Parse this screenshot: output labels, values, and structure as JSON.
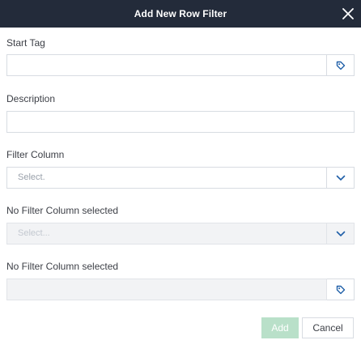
{
  "header": {
    "title": "Add New Row Filter",
    "close_icon": "close-icon"
  },
  "form": {
    "start_tag": {
      "label": "Start Tag",
      "value": "",
      "button_icon": "tag-icon"
    },
    "description": {
      "label": "Description",
      "value": ""
    },
    "filter_column": {
      "label": "Filter Column",
      "placeholder": "Select.",
      "button_icon": "chevron-down-icon"
    },
    "second_column": {
      "label": "No Filter Column selected",
      "placeholder": "Select...",
      "disabled": true,
      "button_icon": "chevron-down-icon"
    },
    "third_column": {
      "label": "No Filter Column selected",
      "value": "",
      "disabled": true,
      "button_icon": "tag-icon"
    }
  },
  "footer": {
    "add_label": "Add",
    "cancel_label": "Cancel"
  },
  "colors": {
    "header_bg": "#232b3a",
    "accent_icon": "#1f5fa8",
    "add_button_disabled": "#b9e0c9"
  }
}
